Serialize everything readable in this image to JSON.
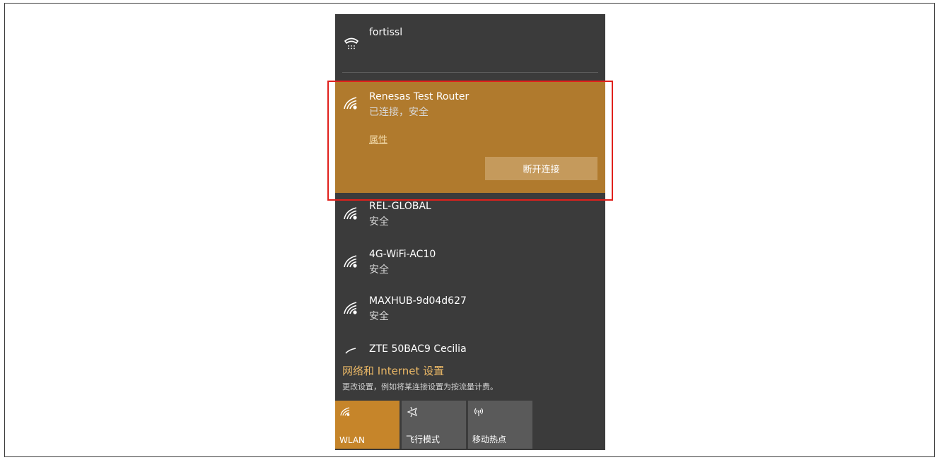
{
  "networks": {
    "vpn": {
      "name": "fortissl",
      "icon": "vpn-phone-icon"
    },
    "connected": {
      "name": "Renesas Test Router",
      "status": "已连接，安全",
      "properties_label": "属性",
      "disconnect_label": "断开连接",
      "icon": "wifi-signal-icon"
    },
    "list": [
      {
        "name": "REL-GLOBAL",
        "status": "安全"
      },
      {
        "name": "4G-WiFi-AC10",
        "status": "安全"
      },
      {
        "name": "MAXHUB-9d04d627",
        "status": "安全"
      },
      {
        "name": "ZTE 50BAC9 Cecilia",
        "status": ""
      }
    ]
  },
  "settings": {
    "title": "网络和 Internet 设置",
    "description": "更改设置，例如将某连接设置为按流量计费。"
  },
  "quick_actions": [
    {
      "label": "WLAN",
      "icon": "wifi-icon",
      "active": true
    },
    {
      "label": "飞行模式",
      "icon": "airplane-icon",
      "active": false
    },
    {
      "label": "移动热点",
      "icon": "hotspot-icon",
      "active": false
    }
  ],
  "colors": {
    "panel_bg": "#3b3b3b",
    "selected_bg": "#b07a2d",
    "accent": "#c6852a",
    "highlight_border": "#e0201c"
  }
}
